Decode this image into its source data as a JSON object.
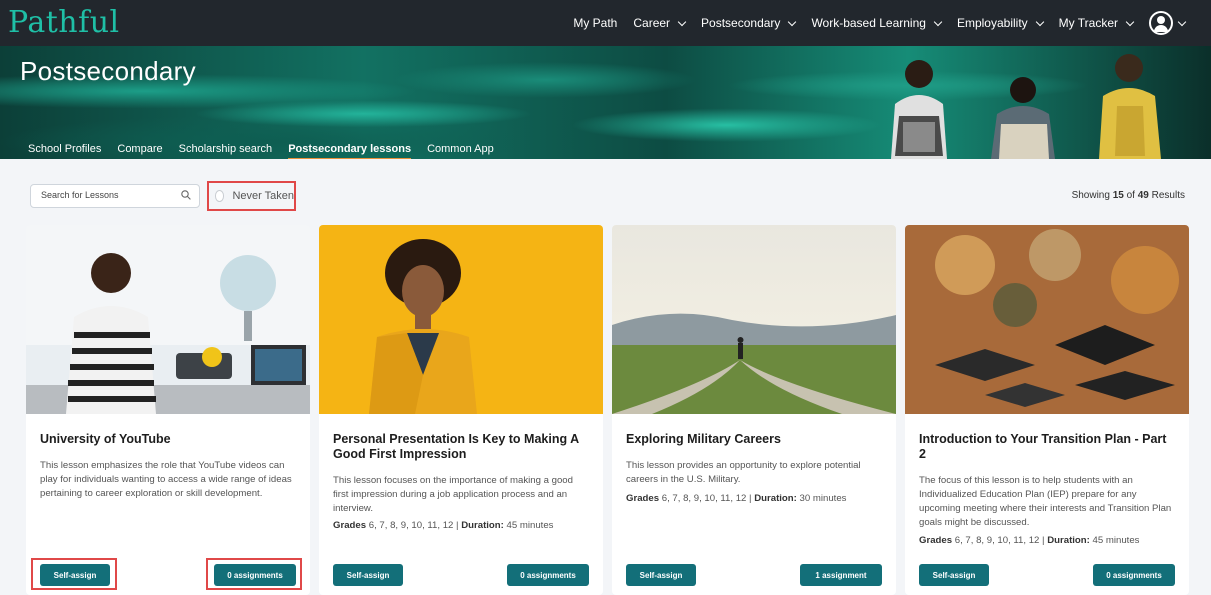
{
  "app": {
    "logo_text": "Pathful"
  },
  "nav": {
    "items": [
      {
        "label": "My Path",
        "dropdown": false
      },
      {
        "label": "Career",
        "dropdown": true
      },
      {
        "label": "Postsecondary",
        "dropdown": true
      },
      {
        "label": "Work-based Learning",
        "dropdown": true
      },
      {
        "label": "Employability",
        "dropdown": true
      },
      {
        "label": "My Tracker",
        "dropdown": true
      }
    ],
    "avatar_icon": "user-circle-icon"
  },
  "hero": {
    "title": "Postsecondary",
    "tabs": [
      {
        "label": "School Profiles",
        "active": false
      },
      {
        "label": "Compare",
        "active": false
      },
      {
        "label": "Scholarship search",
        "active": false
      },
      {
        "label": "Postsecondary lessons",
        "active": true
      },
      {
        "label": "Common App",
        "active": false
      }
    ],
    "accent_color": "#e8913a"
  },
  "filters": {
    "search_placeholder": "Search for Lessons",
    "never_taken_label": "Never Taken",
    "results_prefix": "Showing",
    "results_shown": "15",
    "results_of": "of",
    "results_total": "49",
    "results_suffix": "Results"
  },
  "cards": [
    {
      "title": "University of YouTube",
      "description": "This lesson emphasizes the role that YouTube videos can play for individuals wanting to access a wide range of ideas pertaining to career exploration or skill development.",
      "grades_label": "",
      "grades": "",
      "duration_label": "",
      "duration": "",
      "self_assign_label": "Self-assign",
      "assignments_label": "0 assignments"
    },
    {
      "title": "Personal Presentation Is Key to Making A Good First Impression",
      "description": "This lesson focuses on the importance of making a good first impression during a job application process and an interview.",
      "grades_label": "Grades",
      "grades": "6, 7, 8, 9, 10, 11, 12",
      "duration_label": "Duration:",
      "duration": "45 minutes",
      "self_assign_label": "Self-assign",
      "assignments_label": "0 assignments"
    },
    {
      "title": "Exploring Military Careers",
      "description": "This lesson provides an opportunity to explore potential careers in the U.S. Military.",
      "grades_label": "Grades",
      "grades": "6, 7, 8, 9, 10, 11, 12",
      "duration_label": "Duration:",
      "duration": "30 minutes",
      "self_assign_label": "Self-assign",
      "assignments_label": "1 assignment"
    },
    {
      "title": "Introduction to Your Transition Plan - Part 2",
      "description": "The focus of this lesson is to help students with an Individualized Education Plan (IEP) prepare for any upcoming meeting where their interests and Transition Plan goals might be discussed.",
      "grades_label": "Grades",
      "grades": "6, 7, 8, 9, 10, 11, 12",
      "duration_label": "Duration:",
      "duration": "45 minutes",
      "self_assign_label": "Self-assign",
      "assignments_label": "0 assignments"
    }
  ],
  "colors": {
    "button": "#136f79",
    "topbar": "#22272d",
    "highlight": "#e04848"
  }
}
